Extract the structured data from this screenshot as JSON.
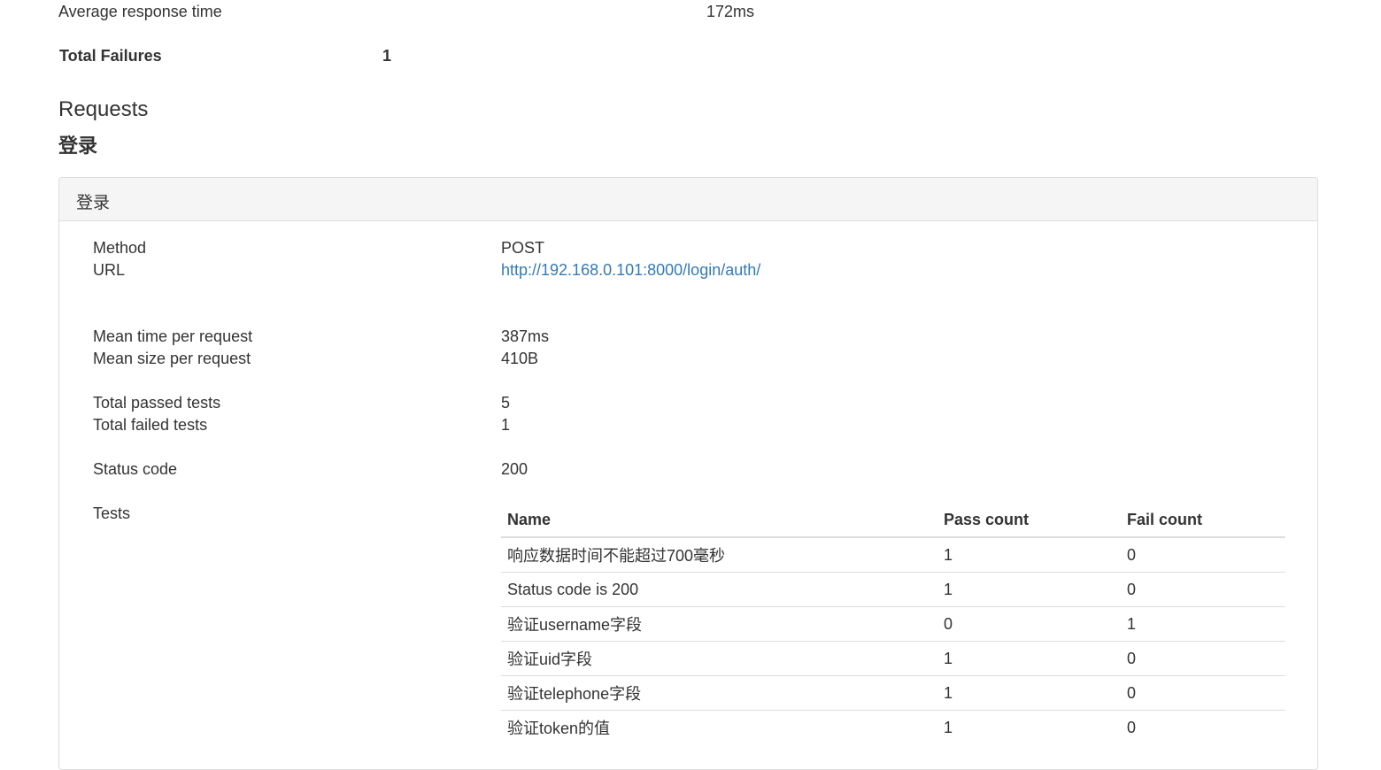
{
  "summary": {
    "avg_response_label": "Average response time",
    "avg_response_value": "172ms",
    "total_failures_label": "Total Failures",
    "total_failures_value": "1"
  },
  "requests": {
    "section_title": "Requests",
    "group_title": "登录",
    "panel_title": "登录",
    "method_label": "Method",
    "method_value": "POST",
    "url_label": "URL",
    "url_value": "http://192.168.0.101:8000/login/auth/",
    "mean_time_label": "Mean time per request",
    "mean_time_value": "387ms",
    "mean_size_label": "Mean size per request",
    "mean_size_value": "410B",
    "passed_label": "Total passed tests",
    "passed_value": "5",
    "failed_label": "Total failed tests",
    "failed_value": "1",
    "status_label": "Status code",
    "status_value": "200",
    "tests_label": "Tests"
  },
  "tests_table": {
    "headers": [
      "Name",
      "Pass count",
      "Fail count"
    ],
    "rows": [
      [
        "响应数据时间不能超过700毫秒",
        "1",
        "0"
      ],
      [
        "Status code is 200",
        "1",
        "0"
      ],
      [
        "验证username字段",
        "0",
        "1"
      ],
      [
        "验证uid字段",
        "1",
        "0"
      ],
      [
        "验证telephone字段",
        "1",
        "0"
      ],
      [
        "验证token的值",
        "1",
        "0"
      ]
    ]
  }
}
